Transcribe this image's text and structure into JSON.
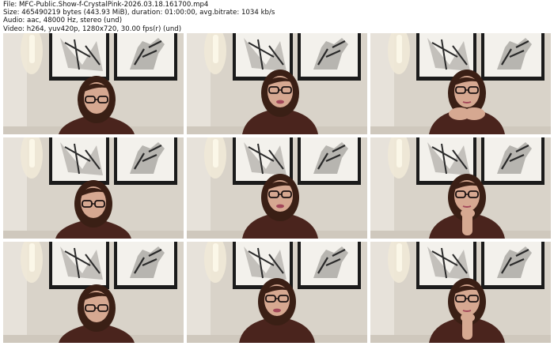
{
  "header": {
    "file_line": "File: MFC-Public.Show-f-CrystalPink-2026.03.18.161700.mp4",
    "size_line": "Size: 465490219 bytes (443.93 MiB), duration: 01:00:00, avg.bitrate: 1034 kb/s",
    "audio_line": "Audio: aac, 48000 Hz, stereo (und)",
    "video_line": "Video: h264, yuv420p, 1280x720, 30.00 fps(r) (und)"
  },
  "thumbnails": [
    {
      "id": 1,
      "pose": "looking-down"
    },
    {
      "id": 2,
      "pose": "talking"
    },
    {
      "id": 3,
      "pose": "hands-under-chin"
    },
    {
      "id": 4,
      "pose": "looking-down"
    },
    {
      "id": 5,
      "pose": "talking"
    },
    {
      "id": 6,
      "pose": "hand-on-chin"
    },
    {
      "id": 7,
      "pose": "looking-down"
    },
    {
      "id": 8,
      "pose": "talking"
    },
    {
      "id": 9,
      "pose": "hand-on-chin"
    }
  ],
  "colors": {
    "wall": "#d9d3c9",
    "frame": "#1b1b1b",
    "mat": "#f3f1ec",
    "sweater": "#4a241d",
    "hair": "#3a1f15",
    "skin": "#d6a891",
    "lamp": "#fbf7e8"
  }
}
